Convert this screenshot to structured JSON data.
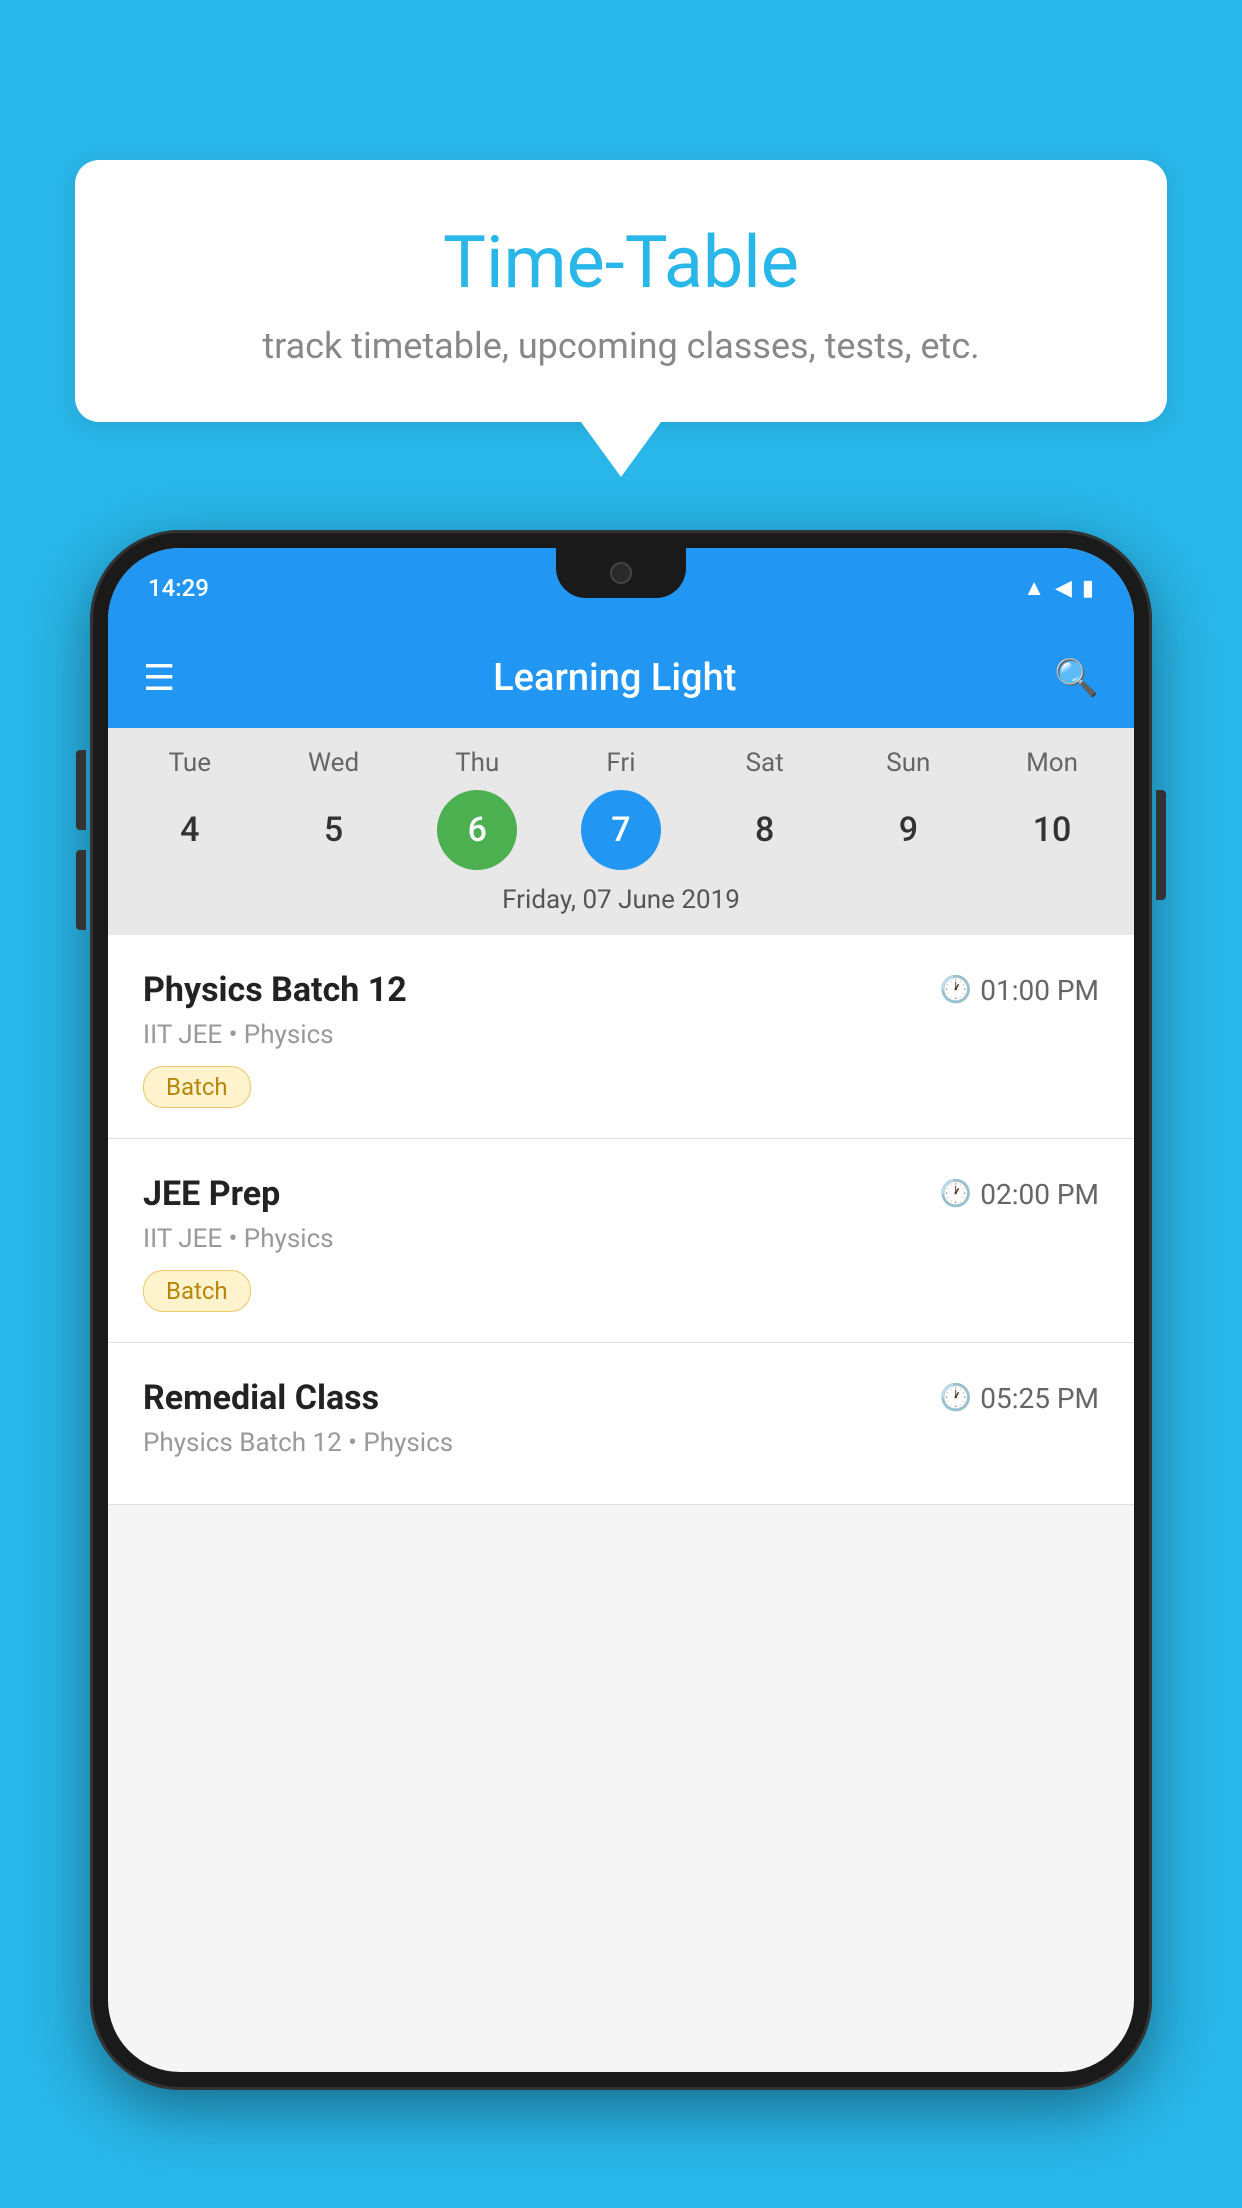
{
  "background_color": "#29b6e8",
  "speech_bubble": {
    "title": "Time-Table",
    "subtitle": "track timetable, upcoming classes, tests, etc."
  },
  "phone": {
    "status_bar": {
      "time": "14:29",
      "icons": [
        "wifi",
        "signal",
        "battery"
      ]
    },
    "app_bar": {
      "title": "Learning Light"
    },
    "calendar": {
      "days": [
        {
          "label": "Tue",
          "num": "4"
        },
        {
          "label": "Wed",
          "num": "5"
        },
        {
          "label": "Thu",
          "num": "6",
          "state": "today"
        },
        {
          "label": "Fri",
          "num": "7",
          "state": "selected"
        },
        {
          "label": "Sat",
          "num": "8"
        },
        {
          "label": "Sun",
          "num": "9"
        },
        {
          "label": "Mon",
          "num": "10"
        }
      ],
      "selected_date_label": "Friday, 07 June 2019"
    },
    "schedule": [
      {
        "title": "Physics Batch 12",
        "time": "01:00 PM",
        "meta": "IIT JEE • Physics",
        "badge": "Batch"
      },
      {
        "title": "JEE Prep",
        "time": "02:00 PM",
        "meta": "IIT JEE • Physics",
        "badge": "Batch"
      },
      {
        "title": "Remedial Class",
        "time": "05:25 PM",
        "meta": "Physics Batch 12 • Physics",
        "badge": null
      }
    ]
  }
}
